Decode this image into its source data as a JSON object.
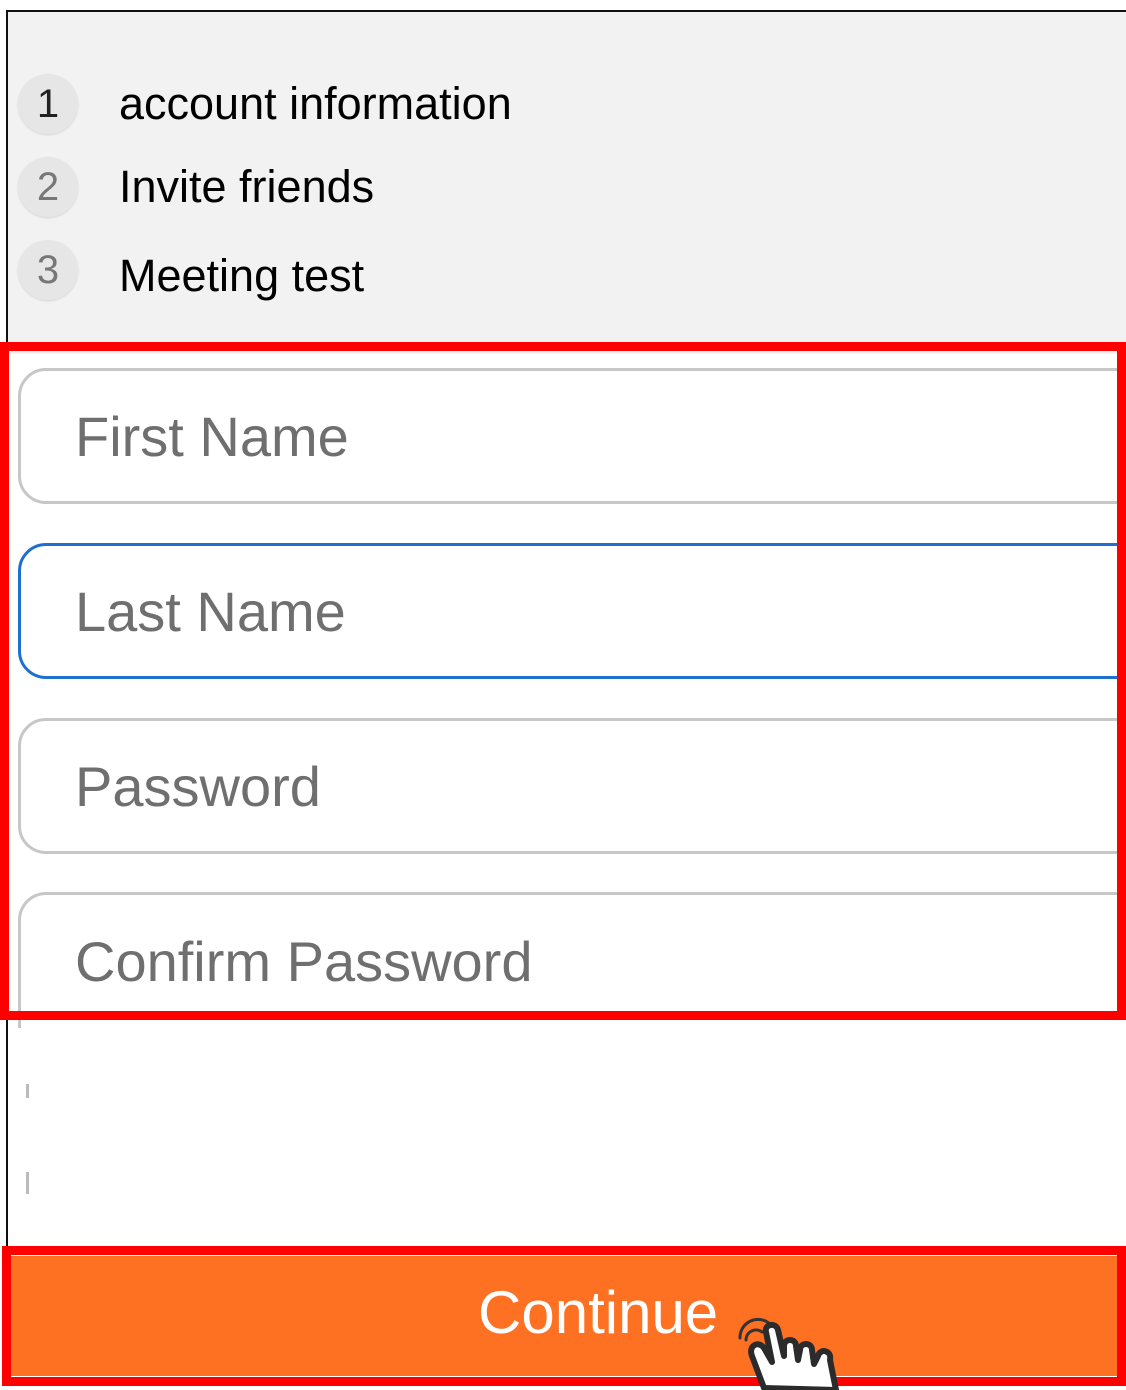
{
  "steps": [
    {
      "number": "1",
      "label": "account information",
      "number_color": "#222222"
    },
    {
      "number": "2",
      "label": "Invite friends",
      "number_color": "#777777"
    },
    {
      "number": "3",
      "label": "Meeting test",
      "number_color": "#777777"
    }
  ],
  "form": {
    "first_name_placeholder": "First Name",
    "last_name_placeholder": "Last Name",
    "password_placeholder": "Password",
    "confirm_password_placeholder": "Confirm Password",
    "focused_field": "Last Name"
  },
  "continue_button": {
    "label": "Continue",
    "color": "#ff7122"
  },
  "colors": {
    "highlight": "#ff0000",
    "focus_border": "#1f6fd1",
    "panel_background": "#f2f2f2"
  },
  "icons": {
    "cursor": "hand-pointer-icon"
  }
}
